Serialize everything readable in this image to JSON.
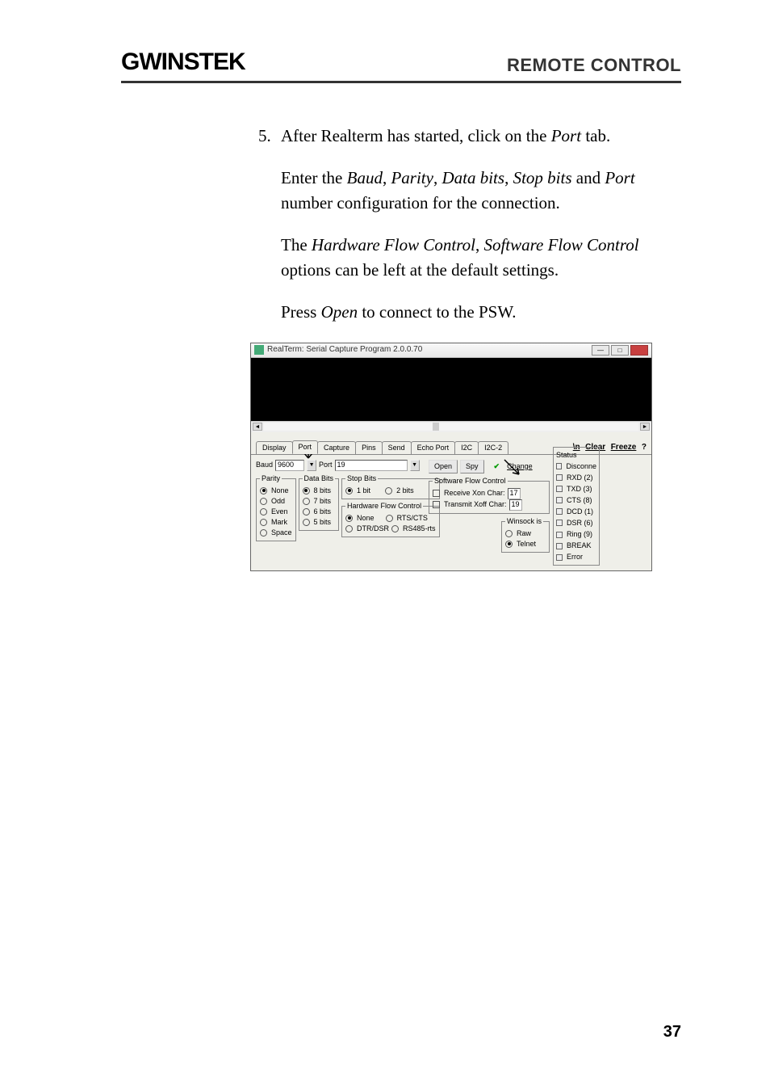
{
  "header": {
    "logo": "GWINSTEK",
    "section": "REMOTE CONTROL"
  },
  "step": {
    "number": "5.",
    "line1_a": "After Realterm has started, click on the ",
    "line1_em": "Port",
    "line1_b": " tab."
  },
  "para2": {
    "a": "Enter the ",
    "em1": "Baud",
    "b": ", ",
    "em2": "Parity",
    "c": ", ",
    "em3": "Data bits",
    "d": ", ",
    "em4": "Stop bits",
    "e": " and ",
    "em5": "Port",
    "f": " number configuration for the connection."
  },
  "para3": {
    "a": "The ",
    "em1": "Hardware Flow Control",
    "b": ", ",
    "em2": "Software Flow Control",
    "c": " options can be left at the default settings."
  },
  "para4": {
    "a": "Press ",
    "em1": "Open",
    "b": " to connect to the PSW."
  },
  "app": {
    "title": "RealTerm: Serial Capture Program 2.0.0.70",
    "tabs": [
      "Display",
      "Port",
      "Capture",
      "Pins",
      "Send",
      "Echo Port",
      "I2C",
      "I2C-2"
    ],
    "toolbar": {
      "ln": "\\n",
      "clear": "Clear",
      "freeze": "Freeze",
      "help": "?"
    },
    "baud_label": "Baud",
    "baud_value": "9600",
    "port_label": "Port",
    "port_value": "19",
    "open_btn": "Open",
    "spy_btn": "Spy",
    "change_btn": "Change",
    "parity": {
      "legend": "Parity",
      "options": [
        "None",
        "Odd",
        "Even",
        "Mark",
        "Space"
      ],
      "selected": "None"
    },
    "databits": {
      "legend": "Data Bits",
      "options": [
        "8 bits",
        "7 bits",
        "6 bits",
        "5 bits"
      ],
      "selected": "8 bits"
    },
    "stopbits": {
      "legend": "Stop Bits",
      "options": [
        "1 bit",
        "2 bits"
      ],
      "selected": "1 bit"
    },
    "hwflow": {
      "legend": "Hardware Flow Control",
      "options": [
        "None",
        "RTS/CTS",
        "DTR/DSR",
        "RS485-rts"
      ],
      "selected": "None"
    },
    "swflow": {
      "legend": "Software Flow Control",
      "rx_label": "Receive Xon Char:",
      "rx_val": "17",
      "tx_label": "Transmit Xoff Char:",
      "tx_val": "19"
    },
    "winsock": {
      "legend": "Winsock is",
      "options": [
        "Raw",
        "Telnet"
      ],
      "selected": "Telnet"
    },
    "status": {
      "legend": "Status",
      "items": [
        "Disconne",
        "RXD (2)",
        "TXD (3)",
        "CTS (8)",
        "DCD (1)",
        "DSR (6)",
        "Ring (9)",
        "BREAK",
        "Error"
      ]
    }
  },
  "page_number": "37"
}
